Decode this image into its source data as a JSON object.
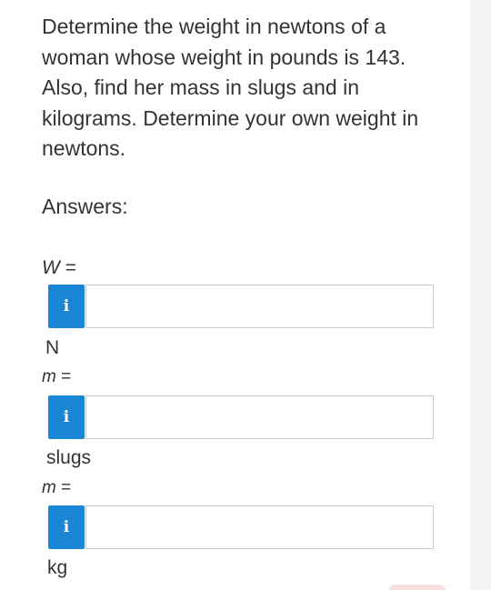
{
  "question": {
    "text": "Determine the weight in newtons of a woman whose weight in pounds is 143. Also, find her mass in slugs and in kilograms. Determine your own weight in newtons."
  },
  "answers": {
    "heading": "Answers:",
    "rows": [
      {
        "var_symbol": "W",
        "equals": "=",
        "info_glyph": "i",
        "value": "",
        "unit": "N"
      },
      {
        "var_symbol": "m",
        "equals": "=",
        "info_glyph": "i",
        "value": "",
        "unit": "slugs"
      },
      {
        "var_symbol": "m",
        "equals": "=",
        "info_glyph": "i",
        "value": "",
        "unit": "kg"
      }
    ]
  },
  "colors": {
    "info_button": "#1a87d6",
    "input_border": "#c9c9c9",
    "text": "#333333"
  },
  "icons": {
    "info": "info-icon"
  }
}
